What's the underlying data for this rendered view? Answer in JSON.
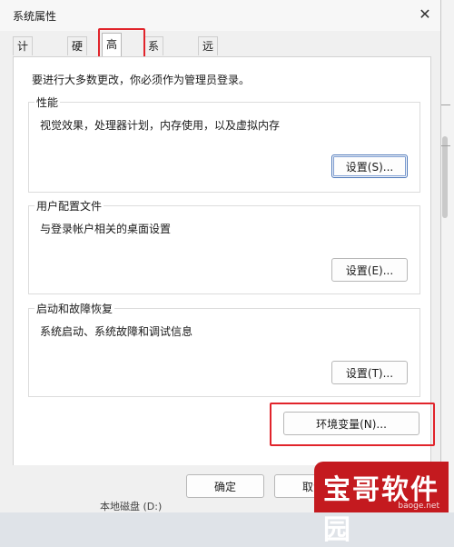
{
  "window": {
    "title": "系统属性"
  },
  "tabs": [
    {
      "label": "计算机名"
    },
    {
      "label": "硬件"
    },
    {
      "label": "高级"
    },
    {
      "label": "系统保护"
    },
    {
      "label": "远程"
    }
  ],
  "active_tab": "高级",
  "admin_notice": "要进行大多数更改，你必须作为管理员登录。",
  "groups": {
    "performance": {
      "title": "性能",
      "description": "视觉效果，处理器计划，内存使用，以及虚拟内存",
      "button": "设置(S)..."
    },
    "user_profiles": {
      "title": "用户配置文件",
      "description": "与登录帐户相关的桌面设置",
      "button": "设置(E)..."
    },
    "startup_recovery": {
      "title": "启动和故障恢复",
      "description": "系统启动、系统故障和调试信息",
      "button": "设置(T)..."
    }
  },
  "env_button": "环境变量(N)...",
  "footer": {
    "ok": "确定",
    "cancel": "取消"
  },
  "background_text": "本地磁盘 (D:)",
  "watermark": {
    "text": "宝哥软件园",
    "subtext": "baoge.net"
  },
  "colors": {
    "highlight": "#e1242b",
    "watermark_bg": "#c41a1f"
  }
}
